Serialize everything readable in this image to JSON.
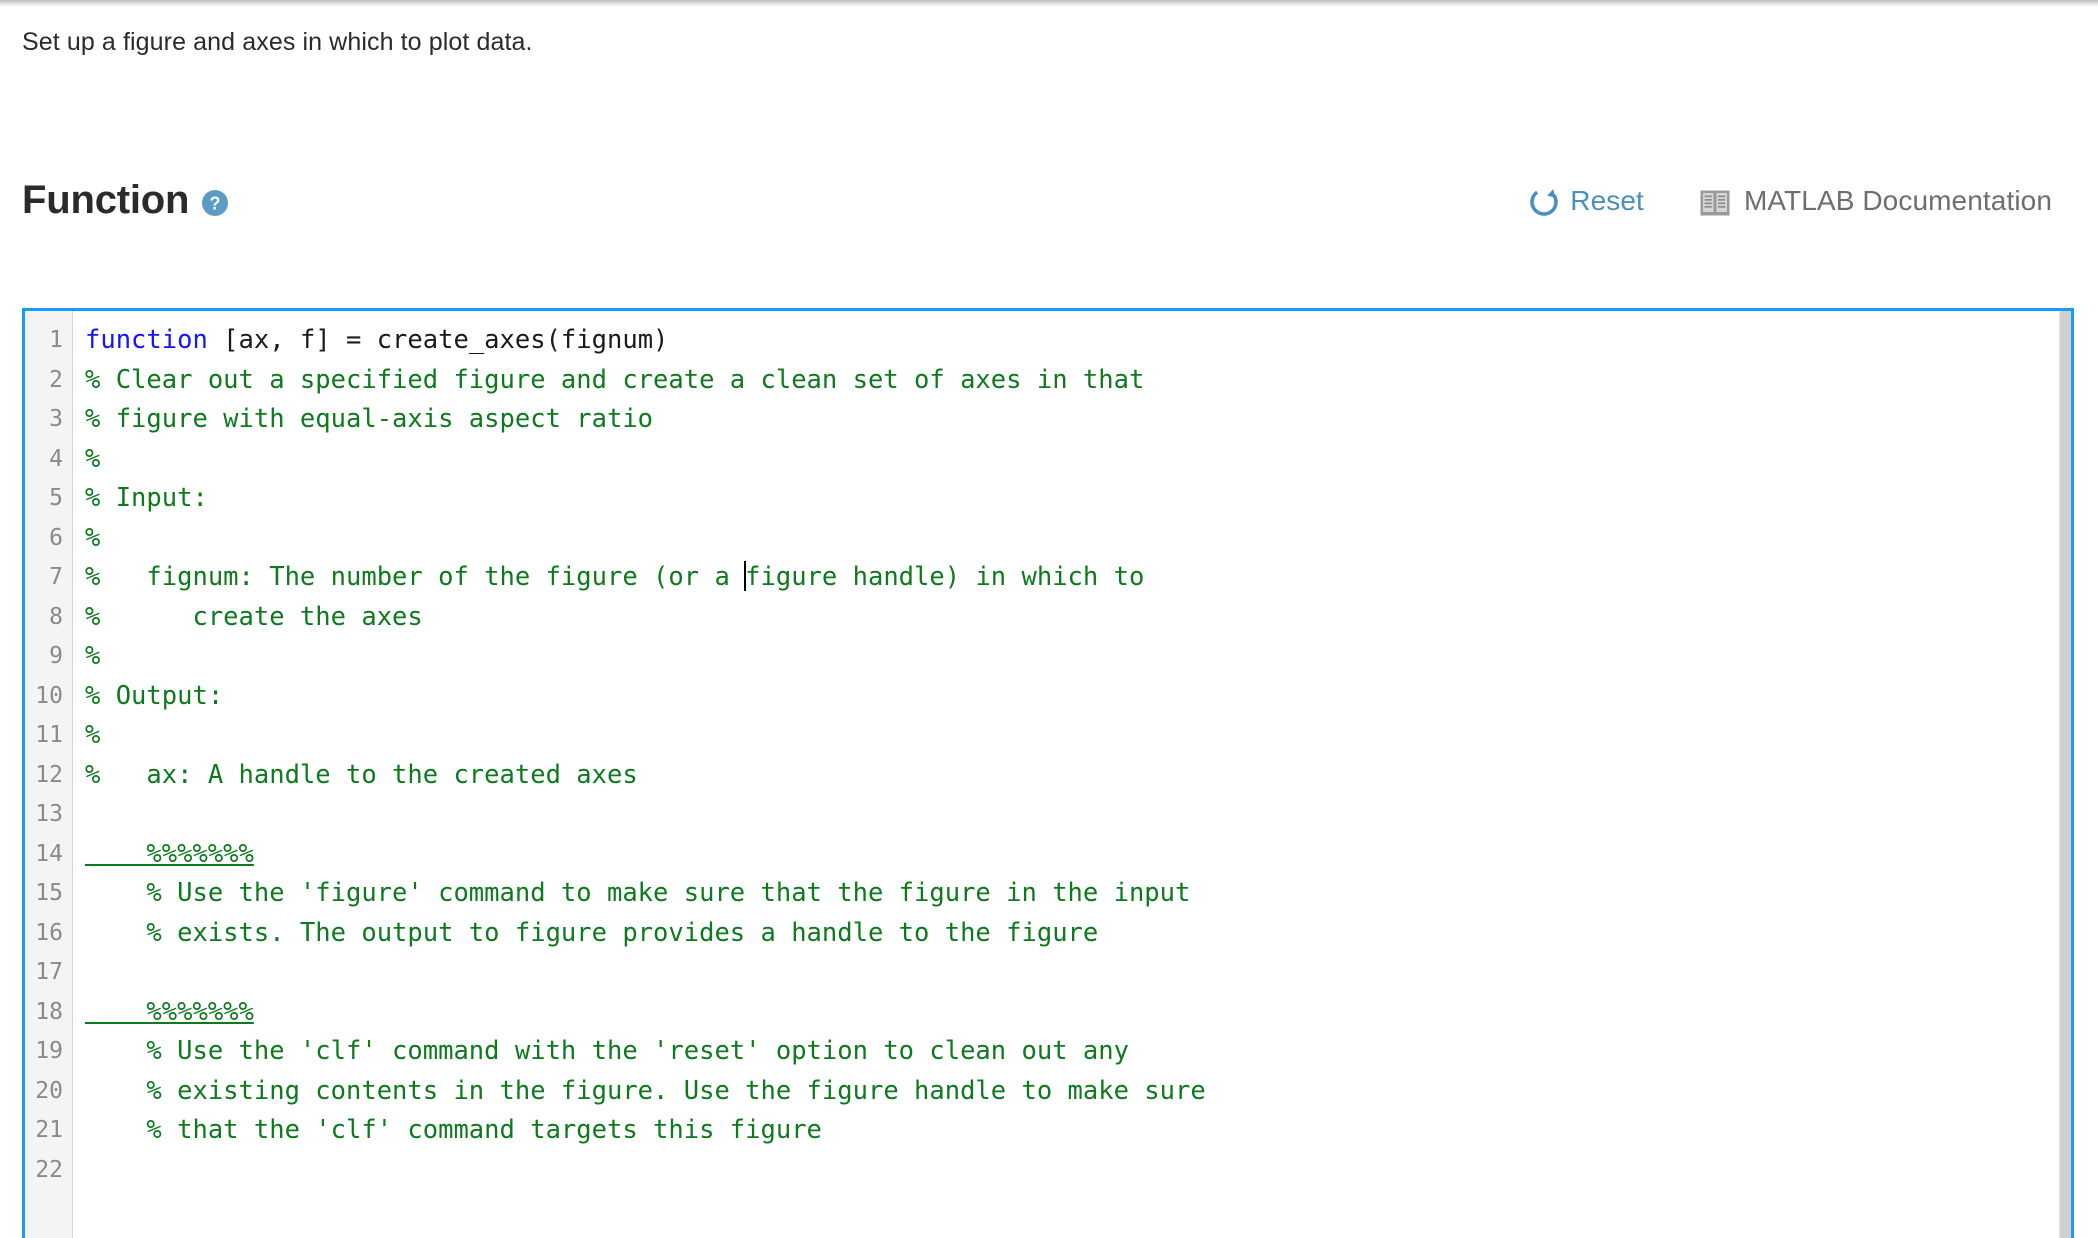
{
  "intro": {
    "text": "Set up a figure and axes in which to plot data."
  },
  "function_panel": {
    "title": "Function",
    "help_icon": "help-circle-icon",
    "reset": {
      "label": "Reset",
      "icon": "refresh-icon",
      "color": "#4a90bf"
    },
    "documentation": {
      "label": "MATLAB Documentation",
      "icon": "book-icon",
      "color": "#6e6e6e"
    }
  },
  "editor": {
    "border_color": "#1a9bfc",
    "keyword_color": "#1414ff",
    "comment_color": "#0e7a1e",
    "text_color": "#1a1a1a",
    "line_numbers": [
      "1",
      "2",
      "3",
      "4",
      "5",
      "6",
      "7",
      "8",
      "9",
      "10",
      "11",
      "12",
      "13",
      "14",
      "15",
      "16",
      "17",
      "18",
      "19",
      "20",
      "21",
      "22"
    ],
    "lines": [
      {
        "n": "1",
        "kind": "code",
        "keyword": "function",
        "rest": " [ax, f] = create_axes(fignum)"
      },
      {
        "n": "2",
        "kind": "comment",
        "text": "% Clear out a specified figure and create a clean set of axes in that"
      },
      {
        "n": "3",
        "kind": "comment",
        "text": "% figure with equal-axis aspect ratio"
      },
      {
        "n": "4",
        "kind": "comment",
        "text": "%"
      },
      {
        "n": "5",
        "kind": "comment",
        "text": "% Input:"
      },
      {
        "n": "6",
        "kind": "comment",
        "text": "%"
      },
      {
        "n": "7",
        "kind": "comment-caret",
        "before": "%   fignum: The number of the figure (or a ",
        "after": "figure handle) in which to"
      },
      {
        "n": "8",
        "kind": "comment",
        "text": "%      create the axes"
      },
      {
        "n": "9",
        "kind": "comment",
        "text": "%"
      },
      {
        "n": "10",
        "kind": "comment",
        "text": "% Output:"
      },
      {
        "n": "11",
        "kind": "comment",
        "text": "%"
      },
      {
        "n": "12",
        "kind": "comment",
        "text": "%   ax: A handle to the created axes"
      },
      {
        "n": "13",
        "kind": "blank",
        "text": ""
      },
      {
        "n": "14",
        "kind": "section",
        "text": "    %%%%%%%"
      },
      {
        "n": "15",
        "kind": "comment",
        "text": "    % Use the 'figure' command to make sure that the figure in the input"
      },
      {
        "n": "16",
        "kind": "comment",
        "text": "    % exists. The output to figure provides a handle to the figure"
      },
      {
        "n": "17",
        "kind": "blank",
        "text": ""
      },
      {
        "n": "18",
        "kind": "section",
        "text": "    %%%%%%%"
      },
      {
        "n": "19",
        "kind": "comment",
        "text": "    % Use the 'clf' command with the 'reset' option to clean out any"
      },
      {
        "n": "20",
        "kind": "comment",
        "text": "    % existing contents in the figure. Use the figure handle to make sure"
      },
      {
        "n": "21",
        "kind": "comment",
        "text": "    % that the 'clf' command targets this figure"
      },
      {
        "n": "22",
        "kind": "blank",
        "text": ""
      }
    ]
  }
}
